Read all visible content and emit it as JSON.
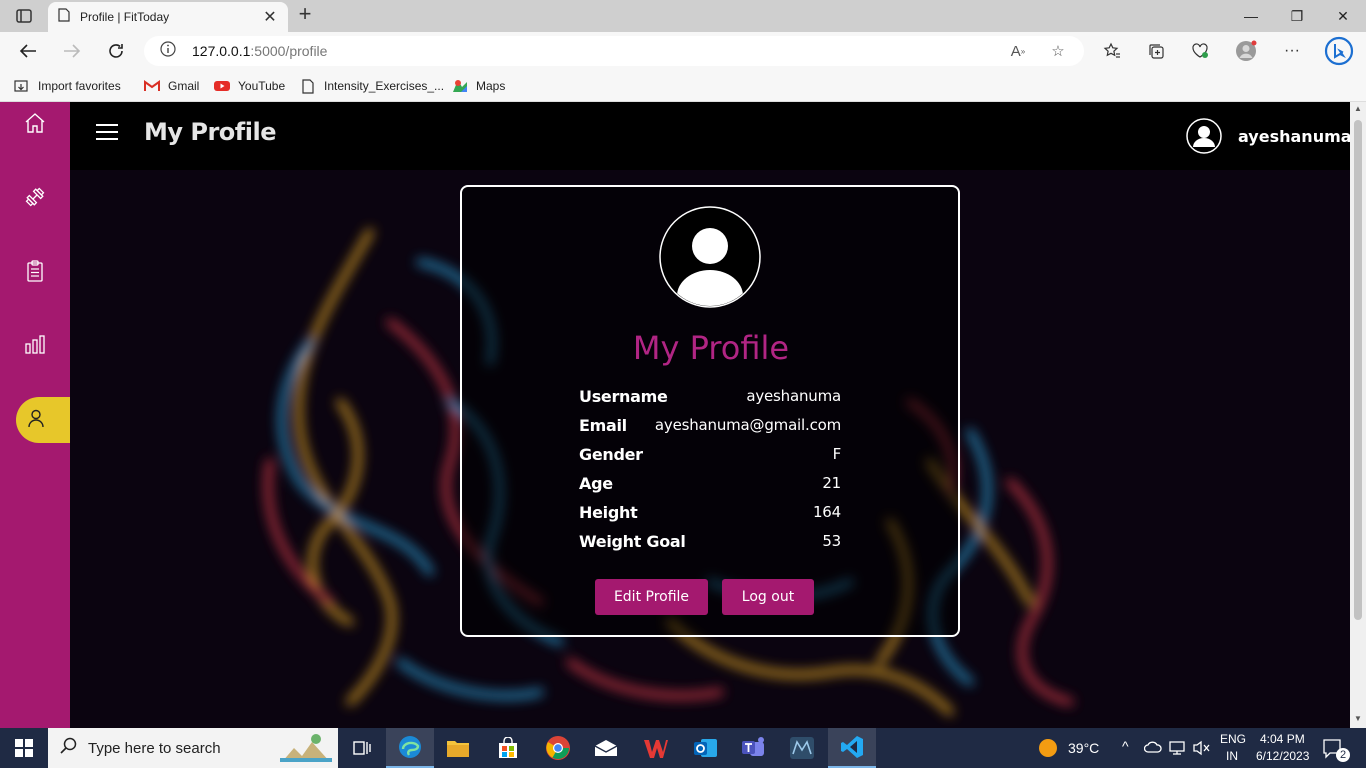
{
  "browser": {
    "tab_title": "Profile | FitToday",
    "url_host": "127.0.0.1",
    "url_rest": ":5000/profile",
    "favorites": [
      {
        "label": "Import favorites",
        "icon": "import-icon"
      },
      {
        "label": "Gmail",
        "icon": "gmail-icon"
      },
      {
        "label": "YouTube",
        "icon": "youtube-icon"
      },
      {
        "label": "Intensity_Exercises_...",
        "icon": "page-icon"
      },
      {
        "label": "Maps",
        "icon": "maps-icon"
      }
    ]
  },
  "sidebar": {
    "items": [
      {
        "name": "home",
        "icon": "home-icon"
      },
      {
        "name": "workouts",
        "icon": "dumbbell-icon"
      },
      {
        "name": "plans",
        "icon": "clipboard-icon"
      },
      {
        "name": "stats",
        "icon": "bar-chart-icon"
      },
      {
        "name": "profile",
        "icon": "user-icon",
        "active": true
      }
    ],
    "accent": "#a4196f",
    "active_color": "#e7c72a"
  },
  "header": {
    "title": "My Profile",
    "username": "ayeshanuma"
  },
  "profile": {
    "heading": "My Profile",
    "fields": [
      {
        "label": "Username",
        "value": "ayeshanuma"
      },
      {
        "label": "Email",
        "value": "ayeshanuma@gmail.com"
      },
      {
        "label": "Gender",
        "value": "F"
      },
      {
        "label": "Age",
        "value": "21"
      },
      {
        "label": "Height",
        "value": "164"
      },
      {
        "label": "Weight Goal",
        "value": "53"
      }
    ],
    "edit_label": "Edit Profile",
    "logout_label": "Log out"
  },
  "taskbar": {
    "search_placeholder": "Type here to search",
    "weather": "39°C",
    "lang_line1": "ENG",
    "lang_line2": "IN",
    "time": "4:04 PM",
    "date": "6/12/2023",
    "notifications": "2"
  }
}
